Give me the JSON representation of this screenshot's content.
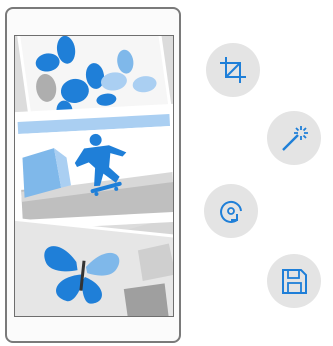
{
  "colors": {
    "accent": "#1f7fd8",
    "accent_light": "#7fb8ea",
    "accent_pale": "#aacff2",
    "button_bg": "#e4e4e4",
    "frame": "#7a7a7a"
  },
  "photo_editor": {
    "actions": [
      {
        "id": "crop",
        "icon": "crop-icon"
      },
      {
        "id": "enhance",
        "icon": "magic-wand-icon"
      },
      {
        "id": "rotate",
        "icon": "rotate-icon"
      },
      {
        "id": "save",
        "icon": "save-floppy-icon"
      }
    ]
  }
}
